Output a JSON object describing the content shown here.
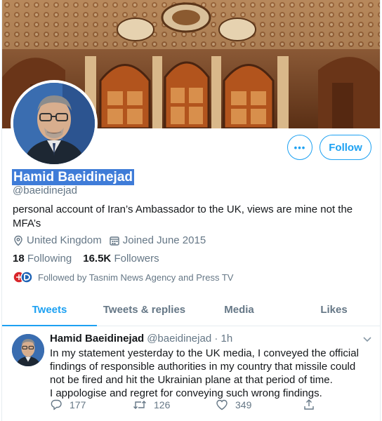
{
  "profile": {
    "name": "Hamid Baeidinejad",
    "handle": "@baeidinejad",
    "bio": "personal account of Iran’s Ambassador to the UK, views are mine not the MFA’s",
    "location": "United Kingdom",
    "joined": "Joined June 2015",
    "following_count": "18",
    "following_label": "Following",
    "followers_count": "16.5K",
    "followers_label": "Followers",
    "followed_by": "Followed by Tasnim News Agency and Press TV"
  },
  "buttons": {
    "more_label": "•••",
    "follow_label": "Follow"
  },
  "tabs": [
    {
      "label": "Tweets",
      "active": true
    },
    {
      "label": "Tweets & replies",
      "active": false
    },
    {
      "label": "Media",
      "active": false
    },
    {
      "label": "Likes",
      "active": false
    }
  ],
  "tweet": {
    "name": "Hamid Baeidinejad",
    "handle_time": "@baeidinejad · 1h",
    "lines": [
      "In my statement yesterday to the UK media, I conveyed the official findings of responsible authorities in my country that missile could not be fired and hit the Ukrainian plane at that period of time.",
      "I appologise and regret for conveying such wrong findings."
    ],
    "reply_count": "177",
    "retweet_count": "126",
    "like_count": "349"
  },
  "colors": {
    "accent": "#1da1f2",
    "secondary_text": "#657786",
    "name_highlight": "#3f7cd8"
  },
  "icons": [
    "location-icon",
    "calendar-icon",
    "reply-icon",
    "retweet-icon",
    "like-icon",
    "share-icon",
    "more-icon",
    "chevron-down-icon"
  ]
}
